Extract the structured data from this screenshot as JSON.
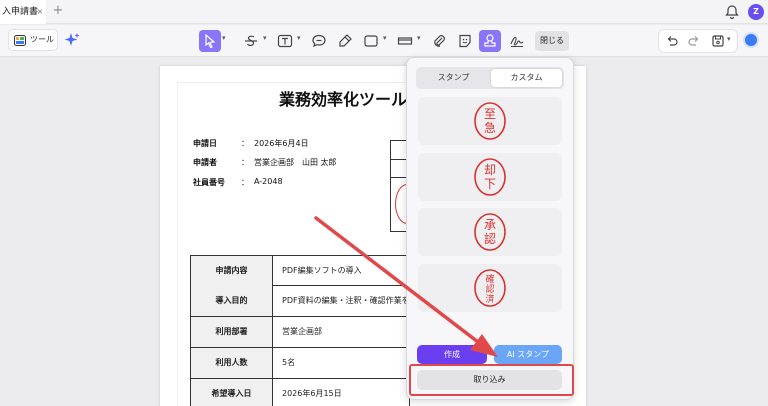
{
  "tab": {
    "title": "入申請書",
    "close": "×",
    "add": "+"
  },
  "header": {
    "avatar_letter": "Z"
  },
  "toolbar": {
    "tools_label": "ツール",
    "close_label": "閉じる"
  },
  "document": {
    "title": "業務効率化ツール導",
    "info": [
      {
        "label": "申請日",
        "colon": "：",
        "value": "2026年6月4日"
      },
      {
        "label": "申請者",
        "colon": "：",
        "value": "営業企画部　山田 太郎"
      },
      {
        "label": "社員番号",
        "colon": "：",
        "value": "A-2048"
      }
    ],
    "table": [
      {
        "header": "申請内容",
        "value": "PDF編集ソフトの導入"
      },
      {
        "header": "導入目的",
        "value": "PDF資料の編集・注釈・確認作業を効"
      },
      {
        "header": "利用部署",
        "value": "営業企画部"
      },
      {
        "header": "利用人数",
        "value": "5名"
      },
      {
        "header": "希望導入日",
        "value": "2026年6月15日"
      }
    ]
  },
  "stamp_panel": {
    "tabs": [
      "スタンプ",
      "カスタム"
    ],
    "selected_tab": "カスタム",
    "stamps": [
      {
        "text": "至急",
        "chars": [
          "至",
          "急"
        ]
      },
      {
        "text": "却下",
        "chars": [
          "却",
          "下"
        ]
      },
      {
        "text": "承認",
        "chars": [
          "承",
          "認"
        ]
      },
      {
        "text": "確認済",
        "chars": [
          "確",
          "認",
          "済"
        ]
      }
    ],
    "create_label": "作成",
    "ai_label": "AI スタンプ",
    "import_label": "取り込み"
  },
  "colors": {
    "accent": "#8a74f7",
    "stamp_red": "#d9322e",
    "highlight": "#e0484b",
    "create": "#6a3ff0",
    "ai": "#6aa6f5"
  }
}
